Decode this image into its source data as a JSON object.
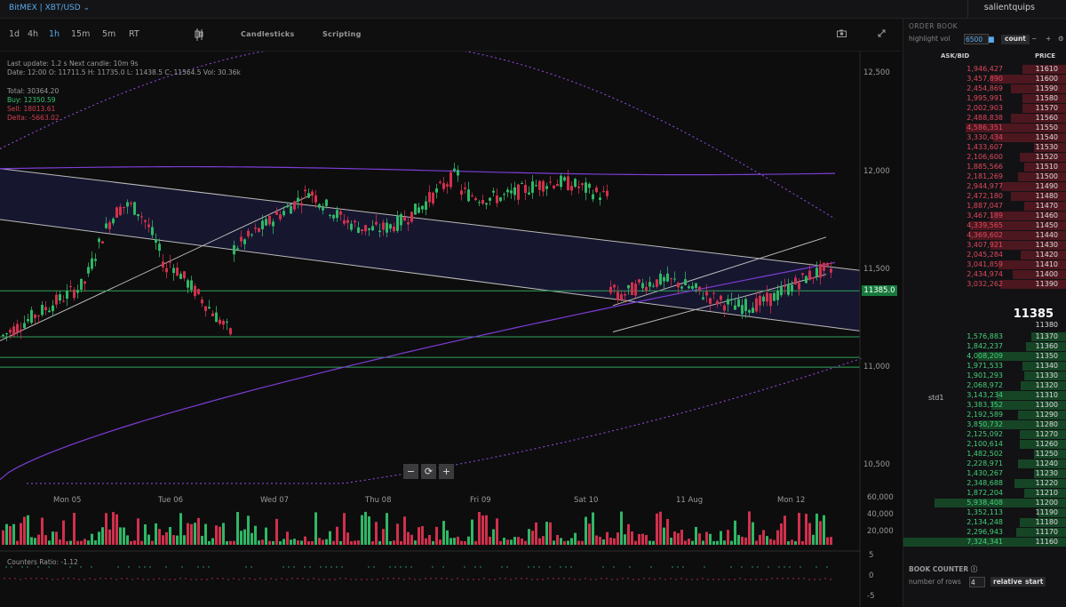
{
  "app": {
    "title": "BitMEX | XBT/USD",
    "user": "salientquips"
  },
  "toolbar": {
    "timeframes": [
      "1d",
      "4h",
      "1h",
      "15m",
      "5m",
      "RT"
    ],
    "active_timeframe": "1h",
    "candlesticks_label": "Candlesticks",
    "scripting_label": "Scripting"
  },
  "info": {
    "line1": "Last update: 1.2 s   Next candle: 10m 9s",
    "line2": "Date: 12:00  O: 11711.5  H: 11735.0  L: 11438.5  C: 11564.5  Vol: 30.36k",
    "total": "Total: 30364.20",
    "buy": "Buy: 12350.59",
    "sell": "Sell: 18013.61",
    "delta": "Delta: -5663.02",
    "counters": "Counters Ratio: -1.12"
  },
  "axes": {
    "price_ticks": [
      "12,500",
      "12,000",
      "11,500",
      "11,000",
      "10,500"
    ],
    "volume_ticks": [
      "60,000",
      "40,000",
      "20,000"
    ],
    "counter_ticks": [
      "5",
      "0",
      "-5"
    ],
    "time_ticks": [
      "Mon 05",
      "Tue 06",
      "Wed 07",
      "Thu 08",
      "Fri 09",
      "Sat 10",
      "11 Aug",
      "Mon 12"
    ]
  },
  "current_price": "11385.0",
  "zoom": {
    "minus": "−",
    "reset": "⟳",
    "plus": "+"
  },
  "order_book": {
    "title": "ORDER BOOK",
    "highlight_label": "highlight vol",
    "highlight_value": "6500",
    "count_label": "count",
    "col_askbid": "ASK/BID",
    "col_price": "PRICE",
    "asks": [
      {
        "q": "1,946,427",
        "p": "11610",
        "w": 0.27
      },
      {
        "q": "3,457,890",
        "p": "11600",
        "w": 0.47
      },
      {
        "q": "2,454,869",
        "p": "11590",
        "w": 0.34
      },
      {
        "q": "1,995,991",
        "p": "11580",
        "w": 0.27
      },
      {
        "q": "2,002,903",
        "p": "11570",
        "w": 0.27
      },
      {
        "q": "2,488,838",
        "p": "11560",
        "w": 0.34
      },
      {
        "q": "4,586,351",
        "p": "11550",
        "w": 0.62
      },
      {
        "q": "3,330,434",
        "p": "11540",
        "w": 0.45
      },
      {
        "q": "1,433,607",
        "p": "11530",
        "w": 0.2
      },
      {
        "q": "2,106,600",
        "p": "11520",
        "w": 0.29
      },
      {
        "q": "1,885,566",
        "p": "11510",
        "w": 0.26
      },
      {
        "q": "2,181,269",
        "p": "11500",
        "w": 0.3
      },
      {
        "q": "2,944,977",
        "p": "11490",
        "w": 0.4
      },
      {
        "q": "2,472,180",
        "p": "11480",
        "w": 0.34
      },
      {
        "q": "1,887,047",
        "p": "11470",
        "w": 0.26
      },
      {
        "q": "3,467,189",
        "p": "11460",
        "w": 0.47
      },
      {
        "q": "4,339,565",
        "p": "11450",
        "w": 0.59
      },
      {
        "q": "4,369,602",
        "p": "11440",
        "w": 0.6
      },
      {
        "q": "3,407,921",
        "p": "11430",
        "w": 0.47
      },
      {
        "q": "2,045,284",
        "p": "11420",
        "w": 0.28
      },
      {
        "q": "3,041,859",
        "p": "11410",
        "w": 0.42
      },
      {
        "q": "2,434,974",
        "p": "11400",
        "w": 0.33
      },
      {
        "q": "3,032,262",
        "p": "11390",
        "w": 0.41
      }
    ],
    "mid_price": "11385",
    "spread_price": "11380",
    "std_label": "std1",
    "bids": [
      {
        "q": "1,576,883",
        "p": "11370",
        "w": 0.22
      },
      {
        "q": "1,842,237",
        "p": "11360",
        "w": 0.25
      },
      {
        "q": "4,008,209",
        "p": "11350",
        "w": 0.55
      },
      {
        "q": "1,971,533",
        "p": "11340",
        "w": 0.27
      },
      {
        "q": "1,901,293",
        "p": "11330",
        "w": 0.26
      },
      {
        "q": "2,068,972",
        "p": "11320",
        "w": 0.28
      },
      {
        "q": "3,143,234",
        "p": "11310",
        "w": 0.43
      },
      {
        "q": "3,383,352",
        "p": "11300",
        "w": 0.46
      },
      {
        "q": "2,192,589",
        "p": "11290",
        "w": 0.3
      },
      {
        "q": "3,850,732",
        "p": "11280",
        "w": 0.53
      },
      {
        "q": "2,125,092",
        "p": "11270",
        "w": 0.29
      },
      {
        "q": "2,100,614",
        "p": "11260",
        "w": 0.29
      },
      {
        "q": "1,482,502",
        "p": "11250",
        "w": 0.2
      },
      {
        "q": "2,228,971",
        "p": "11240",
        "w": 0.3
      },
      {
        "q": "1,430,267",
        "p": "11230",
        "w": 0.2
      },
      {
        "q": "2,348,688",
        "p": "11220",
        "w": 0.32
      },
      {
        "q": "1,872,204",
        "p": "11210",
        "w": 0.26
      },
      {
        "q": "5,938,408",
        "p": "11200",
        "w": 0.81
      },
      {
        "q": "1,352,113",
        "p": "11190",
        "w": 0.18
      },
      {
        "q": "2,134,248",
        "p": "11180",
        "w": 0.29
      },
      {
        "q": "2,296,943",
        "p": "11170",
        "w": 0.31
      },
      {
        "q": "7,324,341",
        "p": "11160",
        "w": 1.0
      }
    ]
  },
  "book_counter": {
    "title": "BOOK COUNTER",
    "rows_label": "number of rows",
    "rows_value": "4",
    "relative_label": "relative",
    "start_label": "start"
  },
  "colors": {
    "up": "#2fb765",
    "down": "#d1304c",
    "accent": "#5aa8e8",
    "purple": "#7d3dd6"
  }
}
